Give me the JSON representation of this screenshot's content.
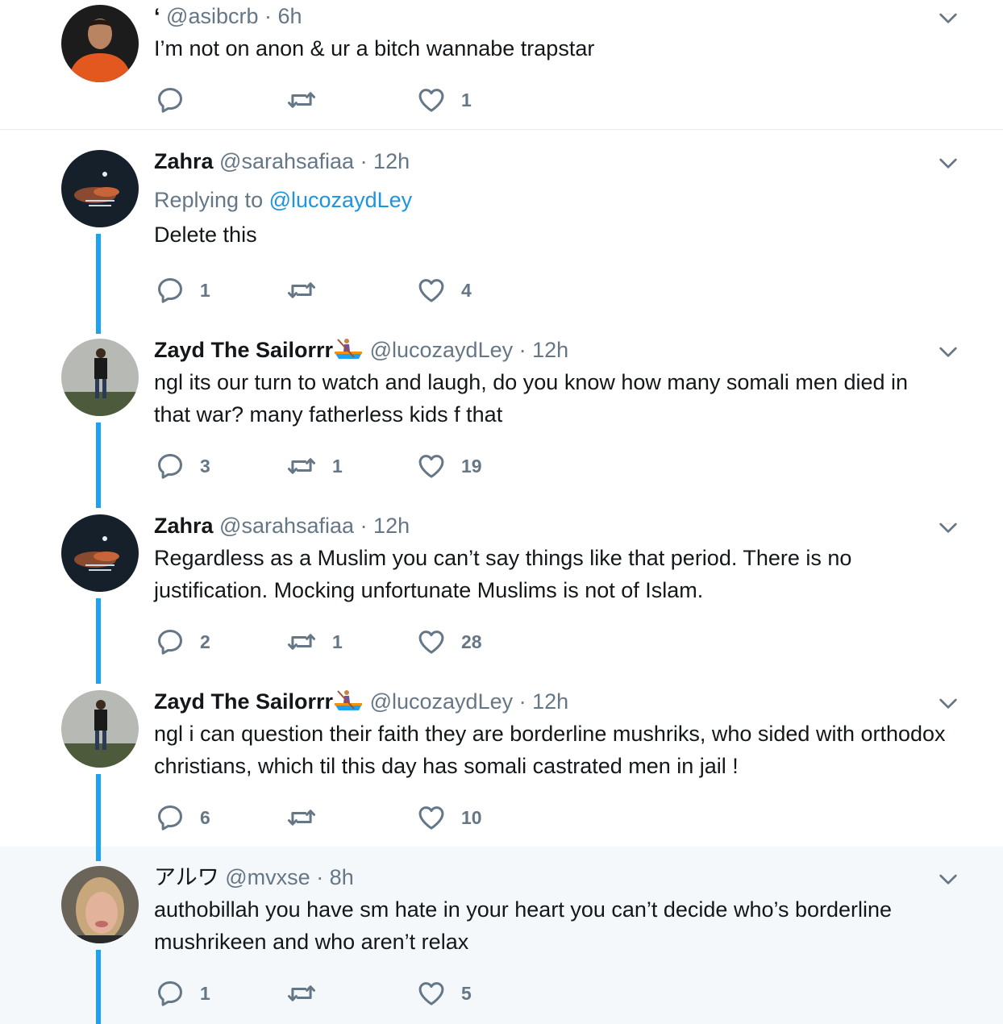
{
  "colors": {
    "accent": "#1da1f2",
    "link": "#1b95e0",
    "muted": "#657786",
    "text": "#14171a"
  },
  "icons": {
    "reply": "speech-bubble-icon",
    "retweet": "retweet-icon",
    "like": "heart-icon",
    "menu": "chevron-down-icon"
  },
  "tweets": [
    {
      "name": "",
      "name_prefix": "‘",
      "handle": "@asibcrb",
      "time": "· 6h",
      "text": "I’m not on anon & ur a bitch wannabe trapstar",
      "replies": "",
      "retweets": "",
      "likes": "1"
    },
    {
      "name": "Zahra",
      "handle": "@sarahsafiaa",
      "time": "· 12h",
      "replying_label": "Replying to",
      "replying_to": "@lucozaydLey",
      "text": "Delete this",
      "replies": "1",
      "retweets": "",
      "likes": "4"
    },
    {
      "name": "Zayd The Sailorrr",
      "emoji": "rowboat-emoji",
      "handle": "@lucozaydLey",
      "time": "· 12h",
      "text": "ngl its our turn to watch and laugh, do you know how many somali men died in that war? many fatherless kids f that",
      "replies": "3",
      "retweets": "1",
      "likes": "19"
    },
    {
      "name": "Zahra",
      "handle": "@sarahsafiaa",
      "time": "· 12h",
      "text": "Regardless as a Muslim you can’t say things like that period. There is no justification. Mocking unfortunate Muslims is not of Islam.",
      "replies": "2",
      "retweets": "1",
      "likes": "28"
    },
    {
      "name": "Zayd The Sailorrr",
      "emoji": "rowboat-emoji",
      "handle": "@lucozaydLey",
      "time": "· 12h",
      "text": "ngl i can question their faith they are borderline mushriks, who sided with orthodox christians, which til this day has somali castrated men in jail !",
      "replies": "6",
      "retweets": "",
      "likes": "10"
    },
    {
      "name": "アルワ",
      "handle": "@mvxse",
      "time": "· 8h",
      "text": "authobillah you have sm hate in your heart you can’t decide who’s borderline mushrikeen and who aren’t relax",
      "replies": "1",
      "retweets": "",
      "likes": "5"
    }
  ]
}
